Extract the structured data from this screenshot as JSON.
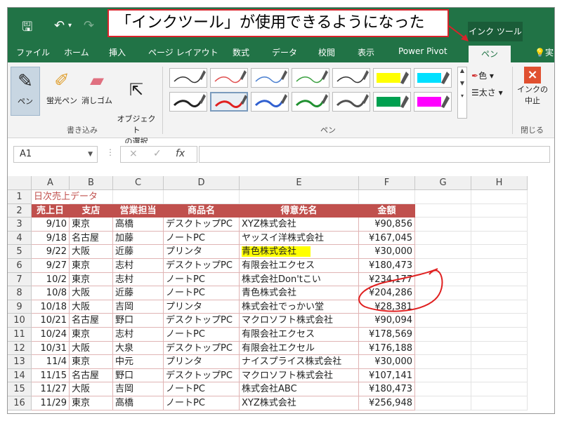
{
  "quick_access": {
    "save_icon": "save-icon",
    "undo_icon": "undo-icon",
    "redo_icon": "redo-icon"
  },
  "callout": {
    "text": "「インクツール」が使用できるようになった"
  },
  "contextual_tab": {
    "label": "インク ツール"
  },
  "tabs": [
    {
      "label": "ファイル"
    },
    {
      "label": "ホーム"
    },
    {
      "label": "挿入"
    },
    {
      "label": "ページ レイアウト"
    },
    {
      "label": "数式"
    },
    {
      "label": "データ"
    },
    {
      "label": "校閲"
    },
    {
      "label": "表示"
    },
    {
      "label": "Power Pivot"
    },
    {
      "label": "ペン"
    },
    {
      "label": "実"
    }
  ],
  "ribbon": {
    "tools": [
      {
        "label": "ペン",
        "icon": "pen-icon"
      },
      {
        "label": "蛍光ペン",
        "icon": "highlighter-icon"
      },
      {
        "label": "消しゴム",
        "icon": "eraser-icon"
      },
      {
        "label": "オブジェクト\nの選択",
        "icon": "select-objects-icon"
      }
    ],
    "group_write": "書き込み",
    "group_pens": "ペン",
    "group_close": "閉じる",
    "color_label": "色",
    "thickness_label": "太さ",
    "stop_label_1": "インクの",
    "stop_label_2": "中止",
    "pen_colors": [
      "#333333",
      "#e05050",
      "#4a7fd0",
      "#3aa040",
      "#333333",
      "#ffff00",
      "#00e0ff",
      "#222222",
      "#e02020",
      "#3060d0",
      "#209030",
      "#505050",
      "#00a050",
      "#ff00ff"
    ]
  },
  "formula_bar": {
    "name_box": "A1",
    "cancel": "×",
    "enter": "✓",
    "fx": "fx"
  },
  "columns": [
    "A",
    "B",
    "C",
    "D",
    "E",
    "F",
    "G",
    "H"
  ],
  "rows": [
    "1",
    "2",
    "3",
    "4",
    "5",
    "6",
    "7",
    "8",
    "9",
    "10",
    "11",
    "12",
    "13",
    "14",
    "15",
    "16"
  ],
  "sheet": {
    "title": "日次売上データ",
    "headers": [
      "売上日",
      "支店",
      "営業担当",
      "商品名",
      "得意先名",
      "金額"
    ],
    "records": [
      [
        "9/10",
        "東京",
        "高橋",
        "デスクトップPC",
        "XYZ株式会社",
        "¥90,856"
      ],
      [
        "9/18",
        "名古屋",
        "加藤",
        "ノートPC",
        "ヤッスイ洋株式会社",
        "¥167,045"
      ],
      [
        "9/22",
        "大阪",
        "近藤",
        "プリンタ",
        "青色株式会社",
        "¥30,000"
      ],
      [
        "9/27",
        "東京",
        "志村",
        "デスクトップPC",
        "有限会社エクセス",
        "¥180,473"
      ],
      [
        "10/2",
        "東京",
        "志村",
        "ノートPC",
        "株式会社Don'tこい",
        "¥234,177"
      ],
      [
        "10/8",
        "大阪",
        "近藤",
        "ノートPC",
        "青色株式会社",
        "¥204,286"
      ],
      [
        "10/18",
        "大阪",
        "吉岡",
        "プリンタ",
        "株式会社でっかい堂",
        "¥28,381"
      ],
      [
        "10/21",
        "名古屋",
        "野口",
        "デスクトップPC",
        "マクロソフト株式会社",
        "¥90,094"
      ],
      [
        "10/24",
        "東京",
        "志村",
        "ノートPC",
        "有限会社エクセス",
        "¥178,569"
      ],
      [
        "10/31",
        "大阪",
        "大泉",
        "デスクトップPC",
        "有限会社エクセル",
        "¥176,188"
      ],
      [
        "11/4",
        "東京",
        "中元",
        "プリンタ",
        "ナイスプライス株式会社",
        "¥30,000"
      ],
      [
        "11/15",
        "名古屋",
        "野口",
        "デスクトップPC",
        "マクロソフト株式会社",
        "¥107,141"
      ],
      [
        "11/27",
        "大阪",
        "吉岡",
        "ノートPC",
        "株式会社ABC",
        "¥180,473"
      ],
      [
        "11/29",
        "東京",
        "高橋",
        "ノートPC",
        "XYZ株式会社",
        "¥256,948"
      ]
    ]
  },
  "highlighted_cell": {
    "row": 3,
    "col": 4,
    "color": "#ffff00"
  },
  "ink_color": "#e02020"
}
